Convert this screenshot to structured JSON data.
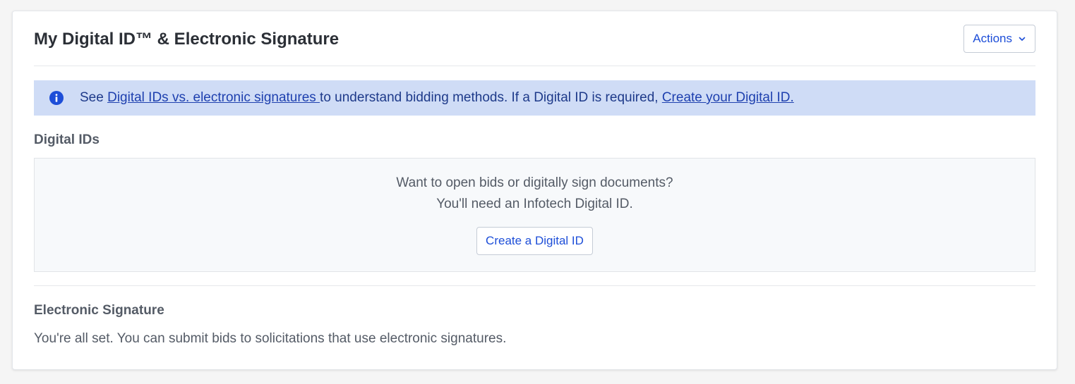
{
  "card": {
    "title": "My Digital ID™ & Electronic Signature",
    "actions_label": "Actions"
  },
  "banner": {
    "prefix": "See ",
    "link1": "Digital IDs vs. electronic signatures ",
    "middle": "to understand bidding methods. If a Digital ID is required, ",
    "link2": "Create your Digital ID."
  },
  "digital_ids": {
    "heading": "Digital IDs",
    "line1": "Want to open bids or digitally sign documents?",
    "line2": "You'll need an Infotech Digital ID.",
    "button_label": "Create a Digital ID"
  },
  "electronic_signature": {
    "heading": "Electronic Signature",
    "text": "You're all set. You can submit bids to solicitations that use electronic signatures."
  },
  "icons": {
    "info": "info-icon",
    "actions_chevron": "chevron-down-icon"
  },
  "colors": {
    "accent": "#1d4ed8",
    "banner_bg": "#cfdcf6",
    "info_icon": "#1d4ed8"
  }
}
